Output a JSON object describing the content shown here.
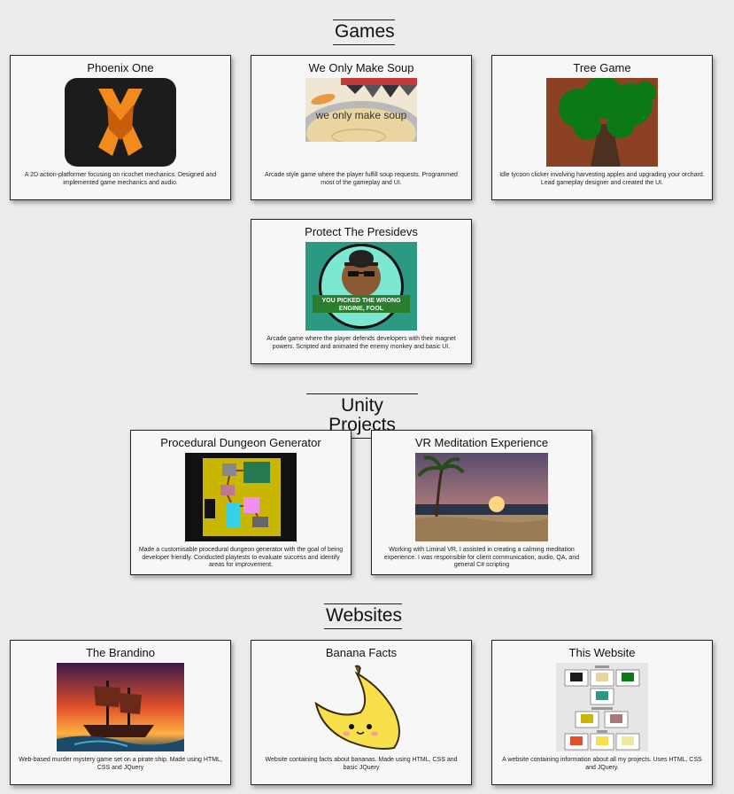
{
  "sections": [
    {
      "heading": "Games",
      "cards": [
        {
          "title": "Phoenix One",
          "description": "A 2D action-platformer focusing on ricochet mechanics. Designed and implemented game mechanics and audio."
        },
        {
          "title": "We Only Make Soup",
          "image_caption": "we only make soup",
          "description": "Arcade style game where the player fulfill soup requests. Programmed most of the gameplay and UI."
        },
        {
          "title": "Tree Game",
          "description": "Idle tycoon clicker involving harvesting apples and upgrading your orchard. Lead gameplay designer and created the UI."
        },
        {
          "title": "Protect The Presidevs",
          "image_caption": "YOU PICKED THE WRONG ENGINE, FOOL",
          "description": "Arcade game where the player defends developers with their magnet powers. Scripted and animated the enemy monkey and basic UI."
        }
      ]
    },
    {
      "heading": "Unity Projects",
      "cards": [
        {
          "title": "Procedural Dungeon Generator",
          "description": "Made a customisable procedural dungeon generator with the goal of being developer friendly. Conducted playtests to evaluate success and identify areas for improvement."
        },
        {
          "title": "VR Meditation Experience",
          "description": "Working with Liminal VR, I assisted in creating a calming meditation experience. I was responsible for client communication, audio, QA, and general C# scripting"
        }
      ]
    },
    {
      "heading": "Websites",
      "cards": [
        {
          "title": "The Brandino",
          "description": "Web-based murder mystery game set on a pirate ship. Made using HTML, CSS and JQuery"
        },
        {
          "title": "Banana Facts",
          "description": "Website containing facts about bananas. Made using HTML, CSS and basic JQuery"
        },
        {
          "title": "This Website",
          "description": "A website containing information about all my projects. Uses HTML, CSS and JQuery."
        }
      ]
    }
  ]
}
